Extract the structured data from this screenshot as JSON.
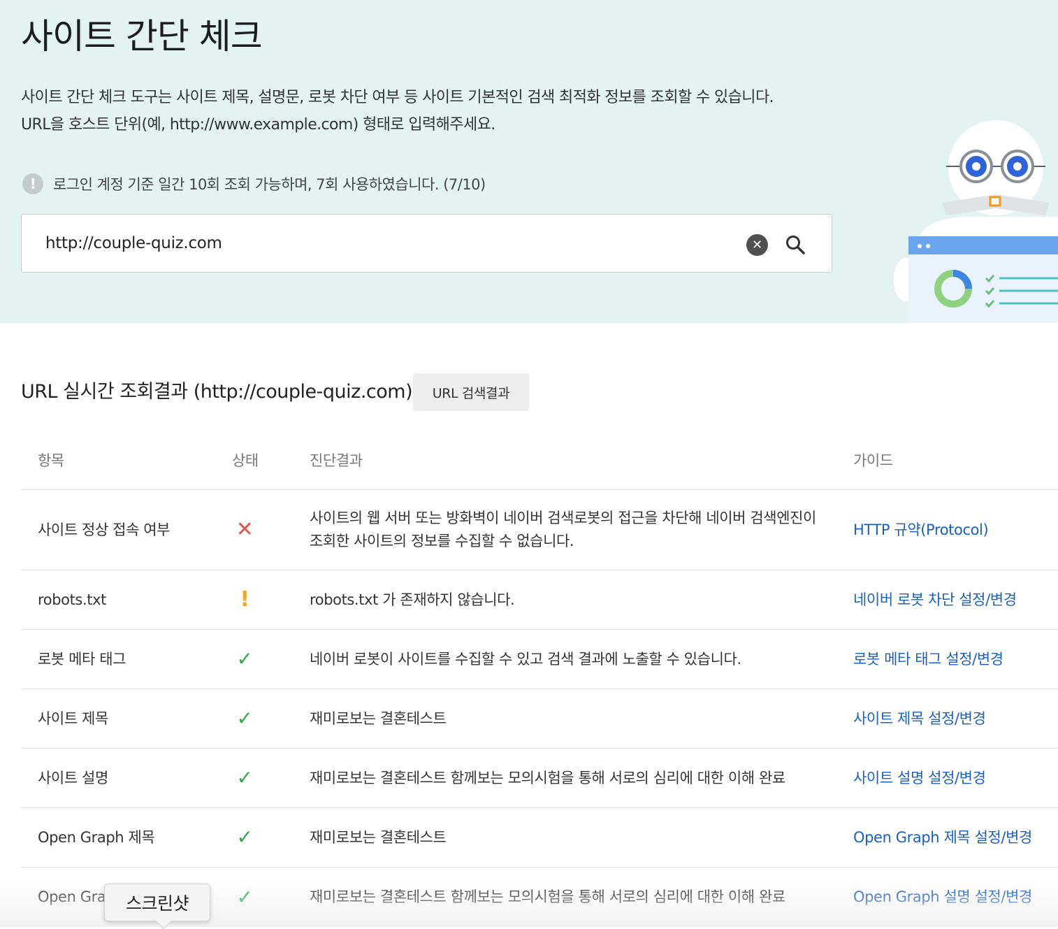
{
  "header": {
    "title": "사이트 간단 체크",
    "description_line1": "사이트 간단 체크 도구는 사이트 제목, 설명문, 로봇 차단 여부 등 사이트 기본적인 검색 최적화 정보를 조회할 수 있습니다.",
    "description_line2": "URL을 호스트 단위(예, http://www.example.com) 형태로 입력해주세요.",
    "notice": "로그인 계정 기준 일간 10회 조회 가능하며, 7회 사용하였습니다. (7/10)",
    "notice_icon": "!"
  },
  "search": {
    "value": "http://couple-quiz.com",
    "clear_icon": "✕"
  },
  "results": {
    "title": "URL 실시간 조회결과 (http://couple-quiz.com)",
    "search_results_button": "URL 검색결과",
    "columns": {
      "item": "항목",
      "status": "상태",
      "result": "진단결과",
      "guide": "가이드"
    },
    "rows": [
      {
        "item": "사이트 정상 접속 여부",
        "status": "error",
        "status_symbol": "✕",
        "result": "사이트의 웹 서버 또는 방화벽이 네이버 검색로봇의 접근을 차단해 네이버 검색엔진이 조회한 사이트의 정보를 수집할 수 없습니다.",
        "guide": "HTTP 규약(Protocol)"
      },
      {
        "item": "robots.txt",
        "status": "warning",
        "status_symbol": "!",
        "result": "robots.txt 가 존재하지 않습니다.",
        "guide": "네이버 로봇 차단 설정/변경"
      },
      {
        "item": "로봇 메타 태그",
        "status": "ok",
        "status_symbol": "✓",
        "result": "네이버 로봇이 사이트를 수집할 수 있고 검색 결과에 노출할 수 있습니다.",
        "guide": "로봇 메타 태그 설정/변경"
      },
      {
        "item": "사이트 제목",
        "status": "ok",
        "status_symbol": "✓",
        "result": "재미로보는 결혼테스트",
        "guide": "사이트 제목 설정/변경"
      },
      {
        "item": "사이트 설명",
        "status": "ok",
        "status_symbol": "✓",
        "result": "재미로보는 결혼테스트 함께보는 모의시험을 통해 서로의 심리에 대한 이해 완료",
        "guide": "사이트 설명 설정/변경"
      },
      {
        "item": "Open Graph 제목",
        "status": "ok",
        "status_symbol": "✓",
        "result": "재미로보는 결혼테스트",
        "guide": "Open Graph 제목 설정/변경"
      },
      {
        "item": "Open Gra",
        "status": "ok",
        "status_symbol": "✓",
        "result": "재미로보는 결혼테스트 함께보는 모의시험을 통해 서로의 심리에 대한 이해 완료",
        "guide": "Open Graph 설명 설정/변경"
      }
    ]
  },
  "tooltip": {
    "text": "스크린샷"
  },
  "colors": {
    "hero_bg": "#e3f3f2",
    "link": "#1a5fc2",
    "status_error": "#e4544c",
    "status_warning": "#f5a623",
    "status_ok": "#34a853"
  },
  "icons": {
    "notice": "exclamation-circle-icon",
    "clear": "clear-circle-icon",
    "search": "magnifier-icon",
    "robot": "robot-illustration"
  }
}
